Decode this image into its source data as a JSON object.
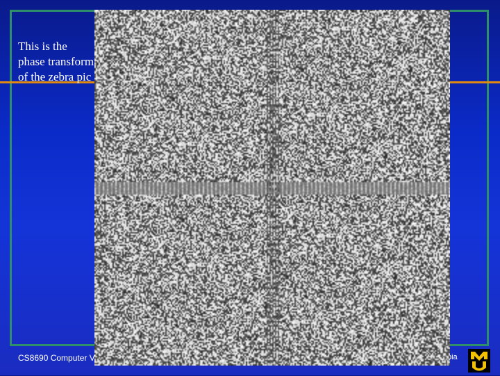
{
  "slide": {
    "caption": "This is the phase transform of the zebra pic",
    "footer_left": "CS8690 Computer V",
    "footer_right": "bia"
  },
  "colors": {
    "background": "#0b2bc8",
    "frame": "#2f8f6a",
    "accent_line": "#e08a10",
    "logo_gold": "#f2c200"
  }
}
